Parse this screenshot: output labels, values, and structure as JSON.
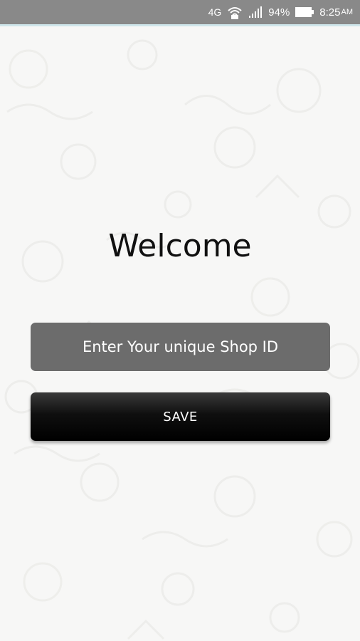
{
  "status_bar": {
    "network": "4G",
    "wifi_icon": "wifi-icon",
    "signal_icon": "signal-icon",
    "battery_percent": "94%",
    "battery_icon": "battery-icon",
    "time": "8:25",
    "time_suffix": "AM"
  },
  "main": {
    "title": "Welcome",
    "shop_id_input": {
      "placeholder": "Enter Your unique Shop ID",
      "value": ""
    },
    "save_label": "SAVE"
  },
  "colors": {
    "status_bar_bg": "#898989",
    "status_accent": "#cfe6ea",
    "background": "#f7f7f6",
    "input_bg": "#6c6c6c",
    "button_bg": "#000000",
    "text_dark": "#111111"
  }
}
